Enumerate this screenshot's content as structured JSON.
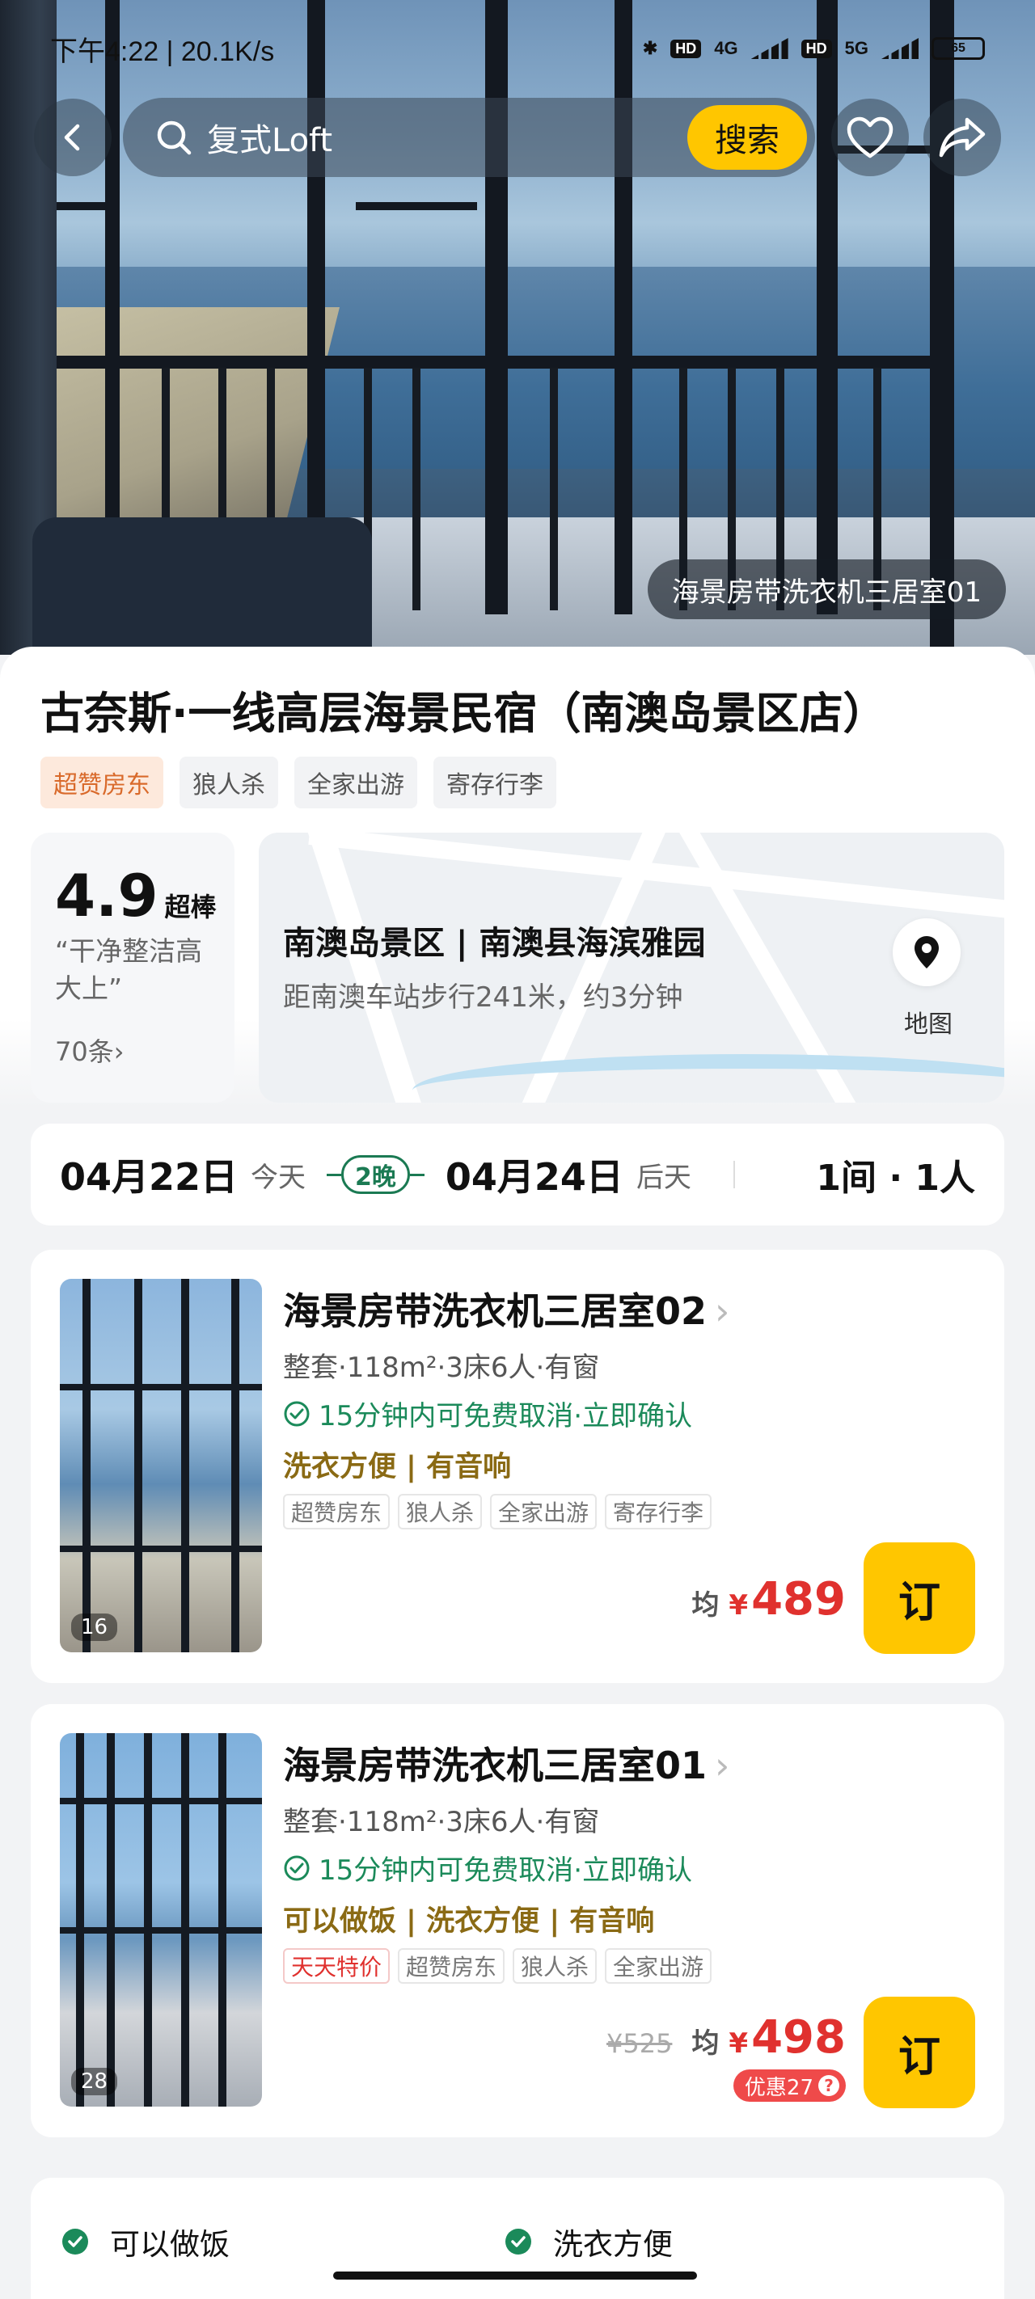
{
  "status_bar": {
    "time_speed": "下午4:22 | 20.1K/s",
    "net1": "HD",
    "net2": "4G",
    "net3": "HD",
    "net4": "5G",
    "battery": "65"
  },
  "header": {
    "search_query": "复式Loft",
    "search_button": "搜索",
    "icons": [
      "back-icon",
      "search-icon",
      "heart-icon",
      "share-icon"
    ]
  },
  "hero": {
    "caption": "海景房带洗衣机三居室01"
  },
  "hotel": {
    "title": "古奈斯·一线高层海景民宿（南澳岛景区店）",
    "tags": [
      "超赞房东",
      "狼人杀",
      "全家出游",
      "寄存行李"
    ]
  },
  "rating": {
    "score": "4.9",
    "grade": "超棒",
    "quote": "“干净整洁高大上”",
    "count": "70条"
  },
  "location": {
    "address": "南澳岛景区 | 南澳县海滨雅园",
    "distance": "距南澳车站步行241米，约3分钟",
    "map_label": "地图"
  },
  "dates": {
    "checkin": "04月22日",
    "checkin_rel": "今天",
    "nights": "2晚",
    "checkout": "04月24日",
    "checkout_rel": "后天",
    "guests": "1间 · 1人"
  },
  "rooms": [
    {
      "name": "海景房带洗衣机三居室02",
      "spec": "整套·118m²·3床6人·有窗",
      "cancel": "15分钟内可免费取消·立即确认",
      "features": "洗衣方便 | 有音响",
      "tags": [
        "超赞房东",
        "狼人杀",
        "全家出游",
        "寄存行李"
      ],
      "photo_count": "16",
      "avg_label": "均",
      "currency": "¥",
      "price": "489",
      "book": "订"
    },
    {
      "name": "海景房带洗衣机三居室01",
      "spec": "整套·118m²·3床6人·有窗",
      "cancel": "15分钟内可免费取消·立即确认",
      "features": "可以做饭 | 洗衣方便 | 有音响",
      "tags": [
        "天天特价",
        "超赞房东",
        "狼人杀",
        "全家出游"
      ],
      "photo_count": "28",
      "original_price": "¥525",
      "avg_label": "均",
      "currency": "¥",
      "price": "498",
      "discount": "优惠27",
      "book": "订"
    }
  ],
  "amenities": [
    "可以做饭",
    "洗衣方便"
  ],
  "colors": {
    "accent_yellow": "#ffc600",
    "price_red": "#e0312e",
    "green": "#1b8a5a",
    "feature_brown": "#8a6a14"
  }
}
